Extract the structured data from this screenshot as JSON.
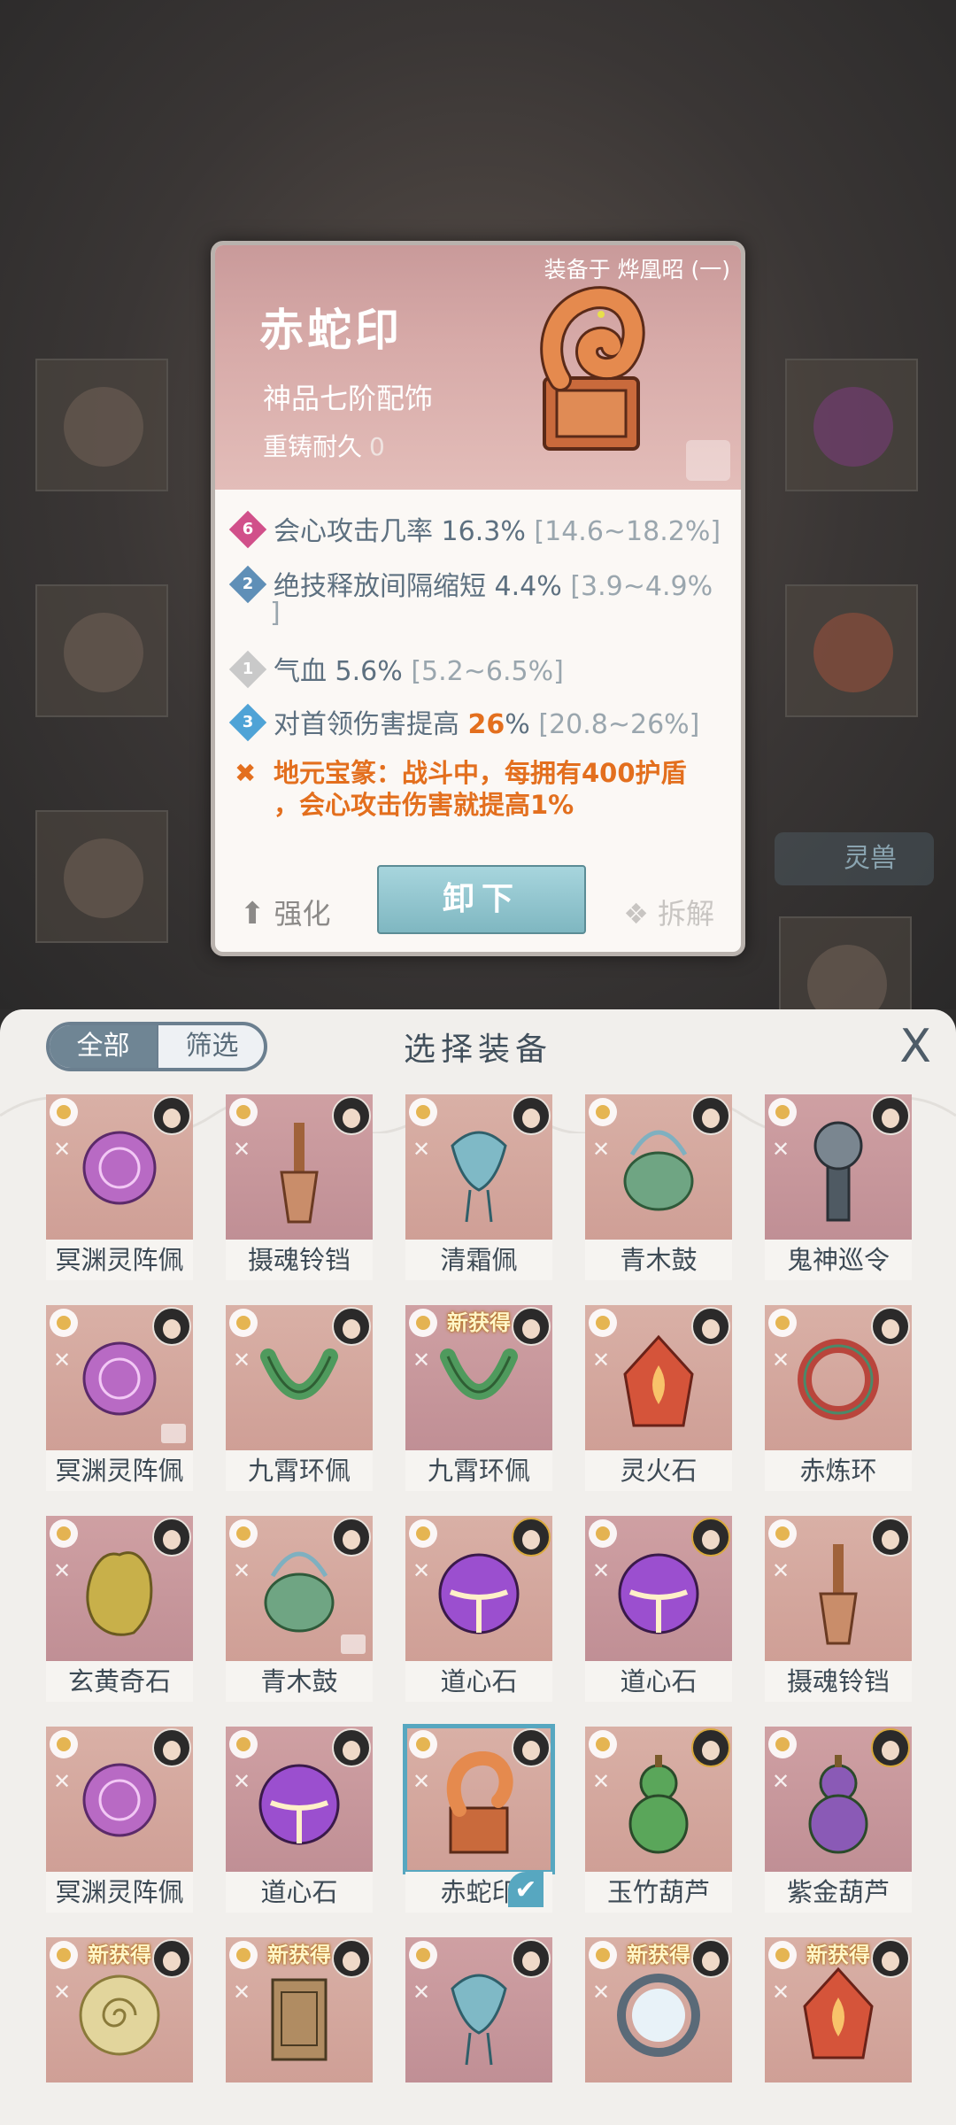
{
  "card": {
    "equipped_to": "装备于 烨凰昭 (一)",
    "name": "赤蛇印",
    "grade": "神品七阶配饰",
    "reforge_label": "重铸耐久",
    "reforge_value": "0",
    "stats": [
      {
        "badge": "6",
        "badge_color": "#d1508a",
        "label": "会心攻击几率",
        "value": "16.3%",
        "range": "[14.6~18.2%]"
      },
      {
        "badge": "2",
        "badge_color": "#5f8fb7",
        "label": "绝技释放间隔缩短",
        "value": "4.4%",
        "range": "[3.9~4.9%",
        "range_tail": "]"
      },
      {
        "badge": "1",
        "badge_color": "#c9c9c9",
        "label": "气血",
        "value": "5.6%",
        "range": "[5.2~6.5%]"
      },
      {
        "badge": "3",
        "badge_color": "#4fa3d6",
        "label": "对首领伤害提高",
        "value": "26",
        "value_suffix": "%",
        "range": "[20.8~26%]"
      }
    ],
    "special_line1": "地元宝篆：战斗中，每拥有400护盾",
    "special_line2": "，会心攻击伤害就提高1%",
    "enhance_label": "强化",
    "unequip_label": "卸下",
    "disassemble_label": "拆解"
  },
  "background": {
    "side_tag": "灵兽"
  },
  "panel": {
    "tab_all": "全部",
    "tab_filter": "筛选",
    "title": "选择装备",
    "close": "X"
  },
  "items": [
    {
      "name": "冥渊灵阵佩",
      "art": "purple-disc",
      "color": "#b86ac4"
    },
    {
      "name": "摄魂铃铛",
      "art": "bell",
      "color": "#c98d6a"
    },
    {
      "name": "清霜佩",
      "art": "jade-pendant",
      "color": "#7fb9c6"
    },
    {
      "name": "青木鼓",
      "art": "drum",
      "color": "#6fa583"
    },
    {
      "name": "鬼神巡令",
      "art": "token",
      "color": "#7a8690"
    },
    {
      "name": "冥渊灵阵佩",
      "art": "purple-disc",
      "color": "#b86ac4"
    },
    {
      "name": "九霄环佩",
      "art": "green-ring",
      "color": "#4f9a5d"
    },
    {
      "name": "九霄环佩",
      "art": "green-ring",
      "color": "#4f9a5d",
      "new": "新获得"
    },
    {
      "name": "灵火石",
      "art": "fire-stone",
      "color": "#d5543a"
    },
    {
      "name": "赤炼环",
      "art": "red-ring",
      "color": "#b9453c"
    },
    {
      "name": "玄黄奇石",
      "art": "yellow-stone",
      "color": "#c8b04a"
    },
    {
      "name": "青木鼓",
      "art": "drum",
      "color": "#6fa583"
    },
    {
      "name": "道心石",
      "art": "orb",
      "color": "#9b4fcf"
    },
    {
      "name": "道心石",
      "art": "orb",
      "color": "#9b4fcf"
    },
    {
      "name": "摄魂铃铛",
      "art": "bell",
      "color": "#c98d6a"
    },
    {
      "name": "冥渊灵阵佩",
      "art": "purple-disc",
      "color": "#b86ac4"
    },
    {
      "name": "道心石",
      "art": "orb",
      "color": "#9b4fcf"
    },
    {
      "name": "赤蛇印",
      "art": "seal",
      "color": "#d2774a",
      "selected": true
    },
    {
      "name": "玉竹葫芦",
      "art": "gourd",
      "color": "#5aa65a"
    },
    {
      "name": "紫金葫芦",
      "art": "gourd",
      "color": "#8a5ab6"
    },
    {
      "name": "",
      "art": "spiral",
      "color": "#e2d59c",
      "new": "新获得"
    },
    {
      "name": "",
      "art": "box",
      "color": "#b08c62",
      "new": "新获得"
    },
    {
      "name": "",
      "art": "jade-pendant",
      "color": "#7fb9c6"
    },
    {
      "name": "",
      "art": "mirror",
      "color": "#9fb8c8",
      "new": "新获得"
    },
    {
      "name": "",
      "art": "fire-stone",
      "color": "#d5543a",
      "new": "新获得"
    }
  ]
}
